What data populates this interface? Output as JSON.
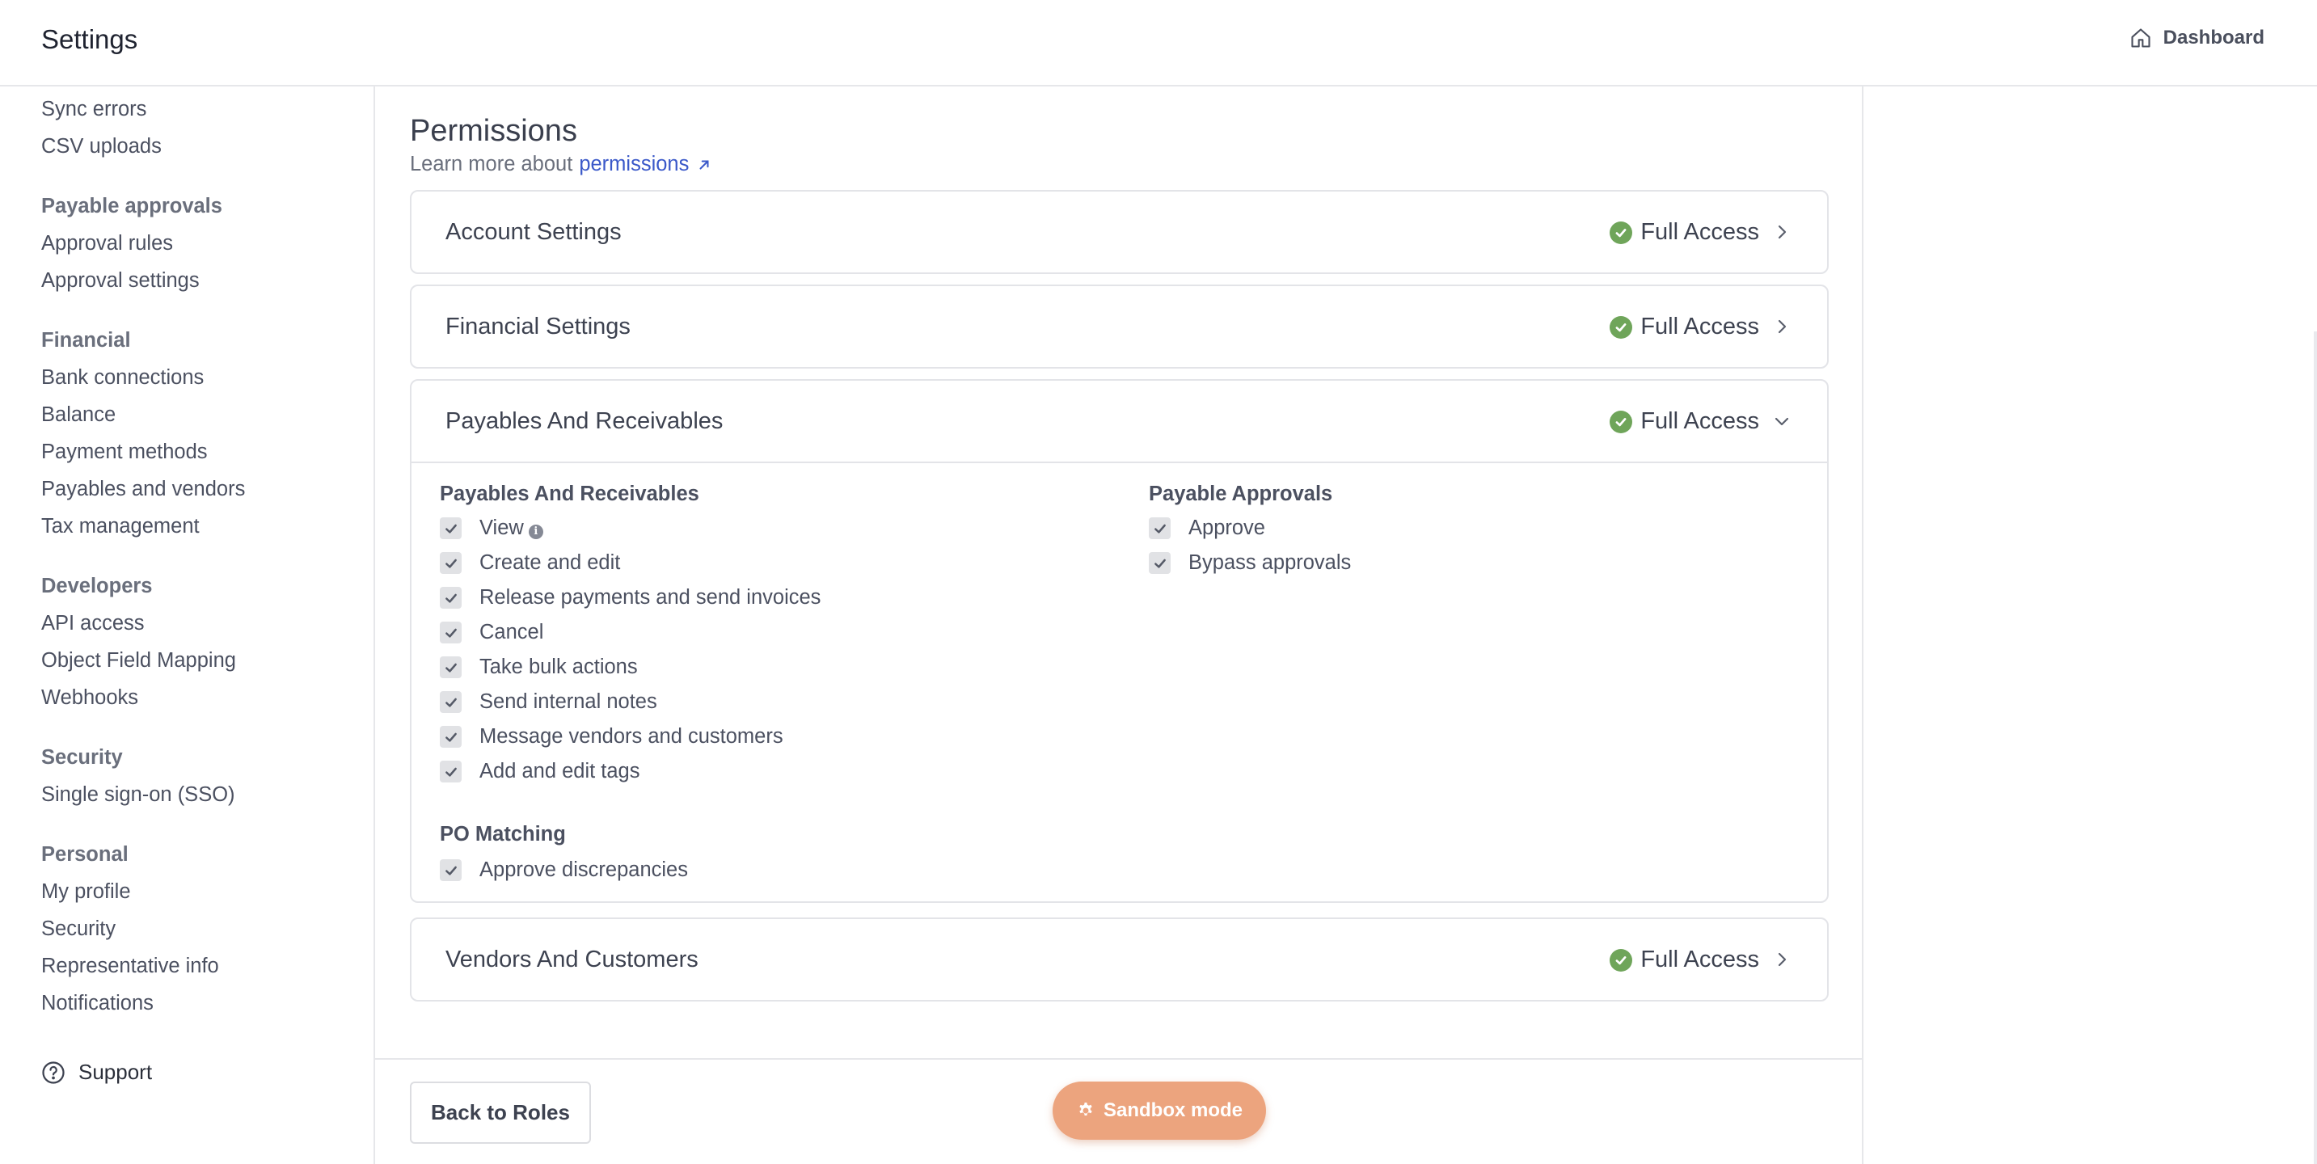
{
  "header": {
    "title": "Settings",
    "dashboard_label": "Dashboard"
  },
  "sidebar": {
    "items_top": [
      "Sync errors",
      "CSV uploads"
    ],
    "groups": [
      {
        "heading": "Payable approvals",
        "items": [
          "Approval rules",
          "Approval settings"
        ]
      },
      {
        "heading": "Financial",
        "items": [
          "Bank connections",
          "Balance",
          "Payment methods",
          "Payables and vendors",
          "Tax management"
        ]
      },
      {
        "heading": "Developers",
        "items": [
          "API access",
          "Object Field Mapping",
          "Webhooks"
        ]
      },
      {
        "heading": "Security",
        "items": [
          "Single sign-on (SSO)"
        ]
      },
      {
        "heading": "Personal",
        "items": [
          "My profile",
          "Security",
          "Representative info",
          "Notifications"
        ]
      }
    ],
    "support_label": "Support"
  },
  "main": {
    "title": "Permissions",
    "subtitle_prefix": "Learn more about",
    "subtitle_link": "permissions",
    "cards": [
      {
        "title": "Account Settings",
        "access": "Full Access",
        "expanded": false
      },
      {
        "title": "Financial Settings",
        "access": "Full Access",
        "expanded": false
      },
      {
        "title": "Payables And Receivables",
        "access": "Full Access",
        "expanded": true
      },
      {
        "title": "Vendors And Customers",
        "access": "Full Access",
        "expanded": false
      }
    ],
    "expanded": {
      "left_group_title": "Payables And Receivables",
      "left_items": [
        "View",
        "Create and edit",
        "Release payments and send invoices",
        "Cancel",
        "Take bulk actions",
        "Send internal notes",
        "Message vendors and customers",
        "Add and edit tags"
      ],
      "po_group_title": "PO Matching",
      "po_items": [
        "Approve discrepancies"
      ],
      "right_group_title": "Payable Approvals",
      "right_items": [
        "Approve",
        "Bypass approvals"
      ]
    },
    "back_button": "Back to Roles",
    "sandbox_label": "Sandbox mode"
  },
  "colors": {
    "accent_link": "#3b59c9",
    "success": "#6fa55a",
    "sandbox": "#eca47e"
  }
}
